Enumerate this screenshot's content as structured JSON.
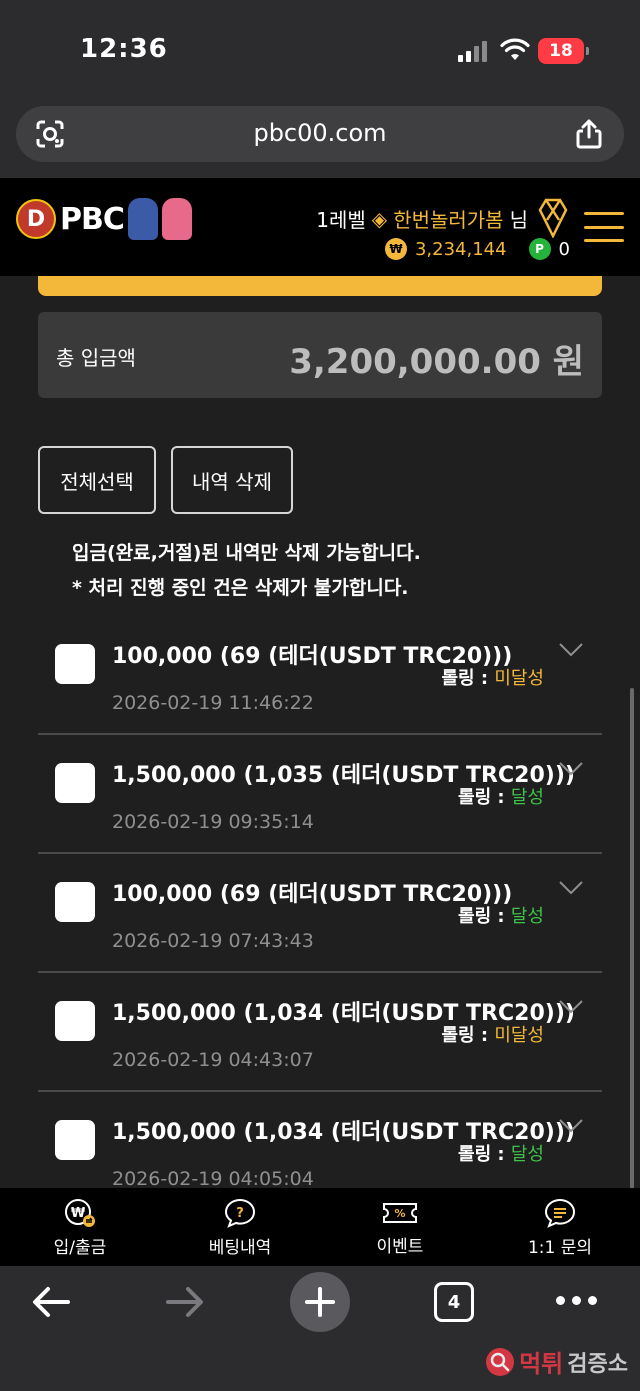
{
  "status_bar": {
    "time": "12:36",
    "battery": "18"
  },
  "browser": {
    "url": "pbc00.com",
    "tab_count": "4"
  },
  "header": {
    "level": "1레벨",
    "nickname": "한번놀러가봄",
    "suffix": "님",
    "coin_symbol": "₩",
    "money": "3,234,144",
    "point_symbol": "P",
    "points": "0"
  },
  "summary": {
    "label": "총 입금액",
    "value": "3,200,000.00 원"
  },
  "actions": {
    "select_all": "전체선택",
    "delete_history": "내역 삭제"
  },
  "notices": [
    "입금(완료,거절)된 내역만 삭제 가능합니다.",
    "* 처리 진행 중인 건은 삭제가 불가합니다."
  ],
  "rolling_label": "롤링 : ",
  "transactions": [
    {
      "title": "100,000 (69 (테더(USDT TRC20)))",
      "status": "미달성",
      "achieved": false,
      "date": "2026-02-19 11:46:22"
    },
    {
      "title": "1,500,000 (1,035 (테더(USDT TRC20)))",
      "status": "달성",
      "achieved": true,
      "date": "2026-02-19 09:35:14"
    },
    {
      "title": "100,000 (69 (테더(USDT TRC20)))",
      "status": "달성",
      "achieved": true,
      "date": "2026-02-19 07:43:43"
    },
    {
      "title": "1,500,000 (1,034 (테더(USDT TRC20)))",
      "status": "미달성",
      "achieved": false,
      "date": "2026-02-19 04:43:07"
    },
    {
      "title": "1,500,000 (1,034 (테더(USDT TRC20)))",
      "status": "달성",
      "achieved": true,
      "date": "2026-02-19 04:05:04"
    }
  ],
  "bottom_nav": [
    {
      "label": "입/출금",
      "icon": "deposit-withdraw-icon"
    },
    {
      "label": "베팅내역",
      "icon": "betting-history-icon"
    },
    {
      "label": "이벤트",
      "icon": "event-ticket-icon"
    },
    {
      "label": "1:1 문의",
      "icon": "chat-inquiry-icon"
    }
  ],
  "watermark": {
    "main": "먹튀",
    "sub": "검증소"
  },
  "colors": {
    "accent": "#f3b73a",
    "achieved": "#3ec24a",
    "not_achieved": "#f3b73a",
    "header_bg": "#000000",
    "page_bg": "#1f1f1f"
  }
}
